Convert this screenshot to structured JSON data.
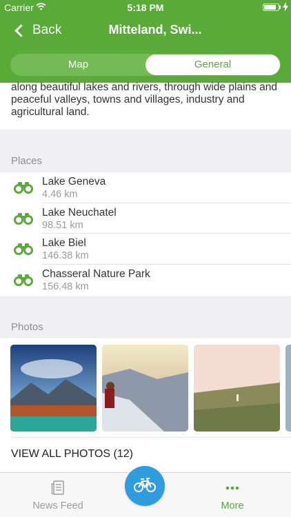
{
  "status_bar": {
    "carrier": "Carrier",
    "time": "5:18 PM",
    "battery_level": 0.9
  },
  "nav": {
    "back_label": "Back",
    "title": "Mitteland, Swi..."
  },
  "segments": [
    {
      "label": "Map",
      "active": false
    },
    {
      "label": "General",
      "active": true
    }
  ],
  "description": "along beautiful lakes and rivers, through wide plains and peaceful valleys, towns and villages, industry and agricultural land.",
  "places": {
    "header": "Places",
    "items": [
      {
        "name": "Lake Geneva",
        "distance": "4.46 km"
      },
      {
        "name": "Lake Neuchatel",
        "distance": "98.51 km"
      },
      {
        "name": "Lake Biel",
        "distance": "146.38 km"
      },
      {
        "name": "Chasseral Nature Park",
        "distance": "156.48 km"
      }
    ]
  },
  "photos": {
    "header": "Photos",
    "view_all_label": "VIEW ALL PHOTOS (12)"
  },
  "tabbar": {
    "news_label": "News Feed",
    "more_label": "More"
  },
  "colors": {
    "brand_green": "#5aaa3a",
    "fab_blue": "#2d9de0"
  },
  "icons": [
    "back-chevron-icon",
    "binoculars-icon",
    "news-feed-icon",
    "bicycle-icon",
    "more-dots-icon",
    "wifi-icon",
    "battery-icon"
  ]
}
